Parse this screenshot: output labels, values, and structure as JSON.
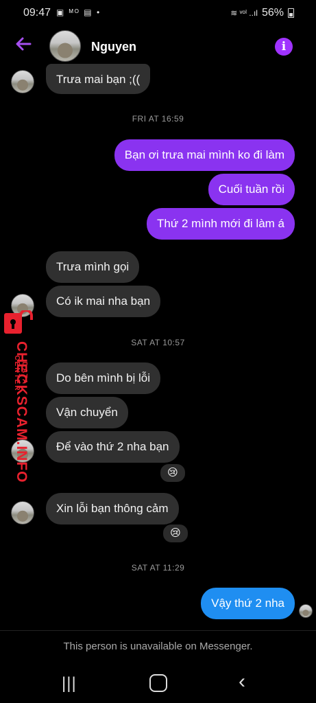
{
  "status_bar": {
    "time": "09:47",
    "left_icons": "▣ ᴹᴼ ▤ •",
    "right_icons": "≋ ᵛᵒˡ ..ıl",
    "battery": "56%"
  },
  "header": {
    "contact_name": "Nguyen",
    "back_icon": "arrow-left-icon",
    "info_icon": "info-icon",
    "accent_color": "#a033ff"
  },
  "messages": {
    "m1": "Trưa mai bạn ;((",
    "ts1": "FRI AT 16:59",
    "m2": "Bạn ơi trưa mai mình ko đi làm",
    "m3": "Cuối tuần rồi",
    "m4": "Thứ 2 mình mới đi làm á",
    "m5": "Trưa mình gọi",
    "m6": "Có ik mai nha bạn",
    "ts2": "SAT AT 10:57",
    "m7": "Do bên mình bị lỗi",
    "m8": "Vận chuyển",
    "m9": "Để vào thứ 2 nha bạn",
    "r1": "😢",
    "m10": "Xin lỗi bạn thông cảm",
    "r2": "😢",
    "ts3": "SAT AT 11:29",
    "m11": "Vậy thứ 2 nha"
  },
  "watermark": {
    "main": "CHECKSCAM.INFO",
    "sub": "DATA CENTER"
  },
  "footer": {
    "unavailable": "This person is unavailable on Messenger."
  },
  "nav": {
    "recent": "|||",
    "back": "‹"
  }
}
